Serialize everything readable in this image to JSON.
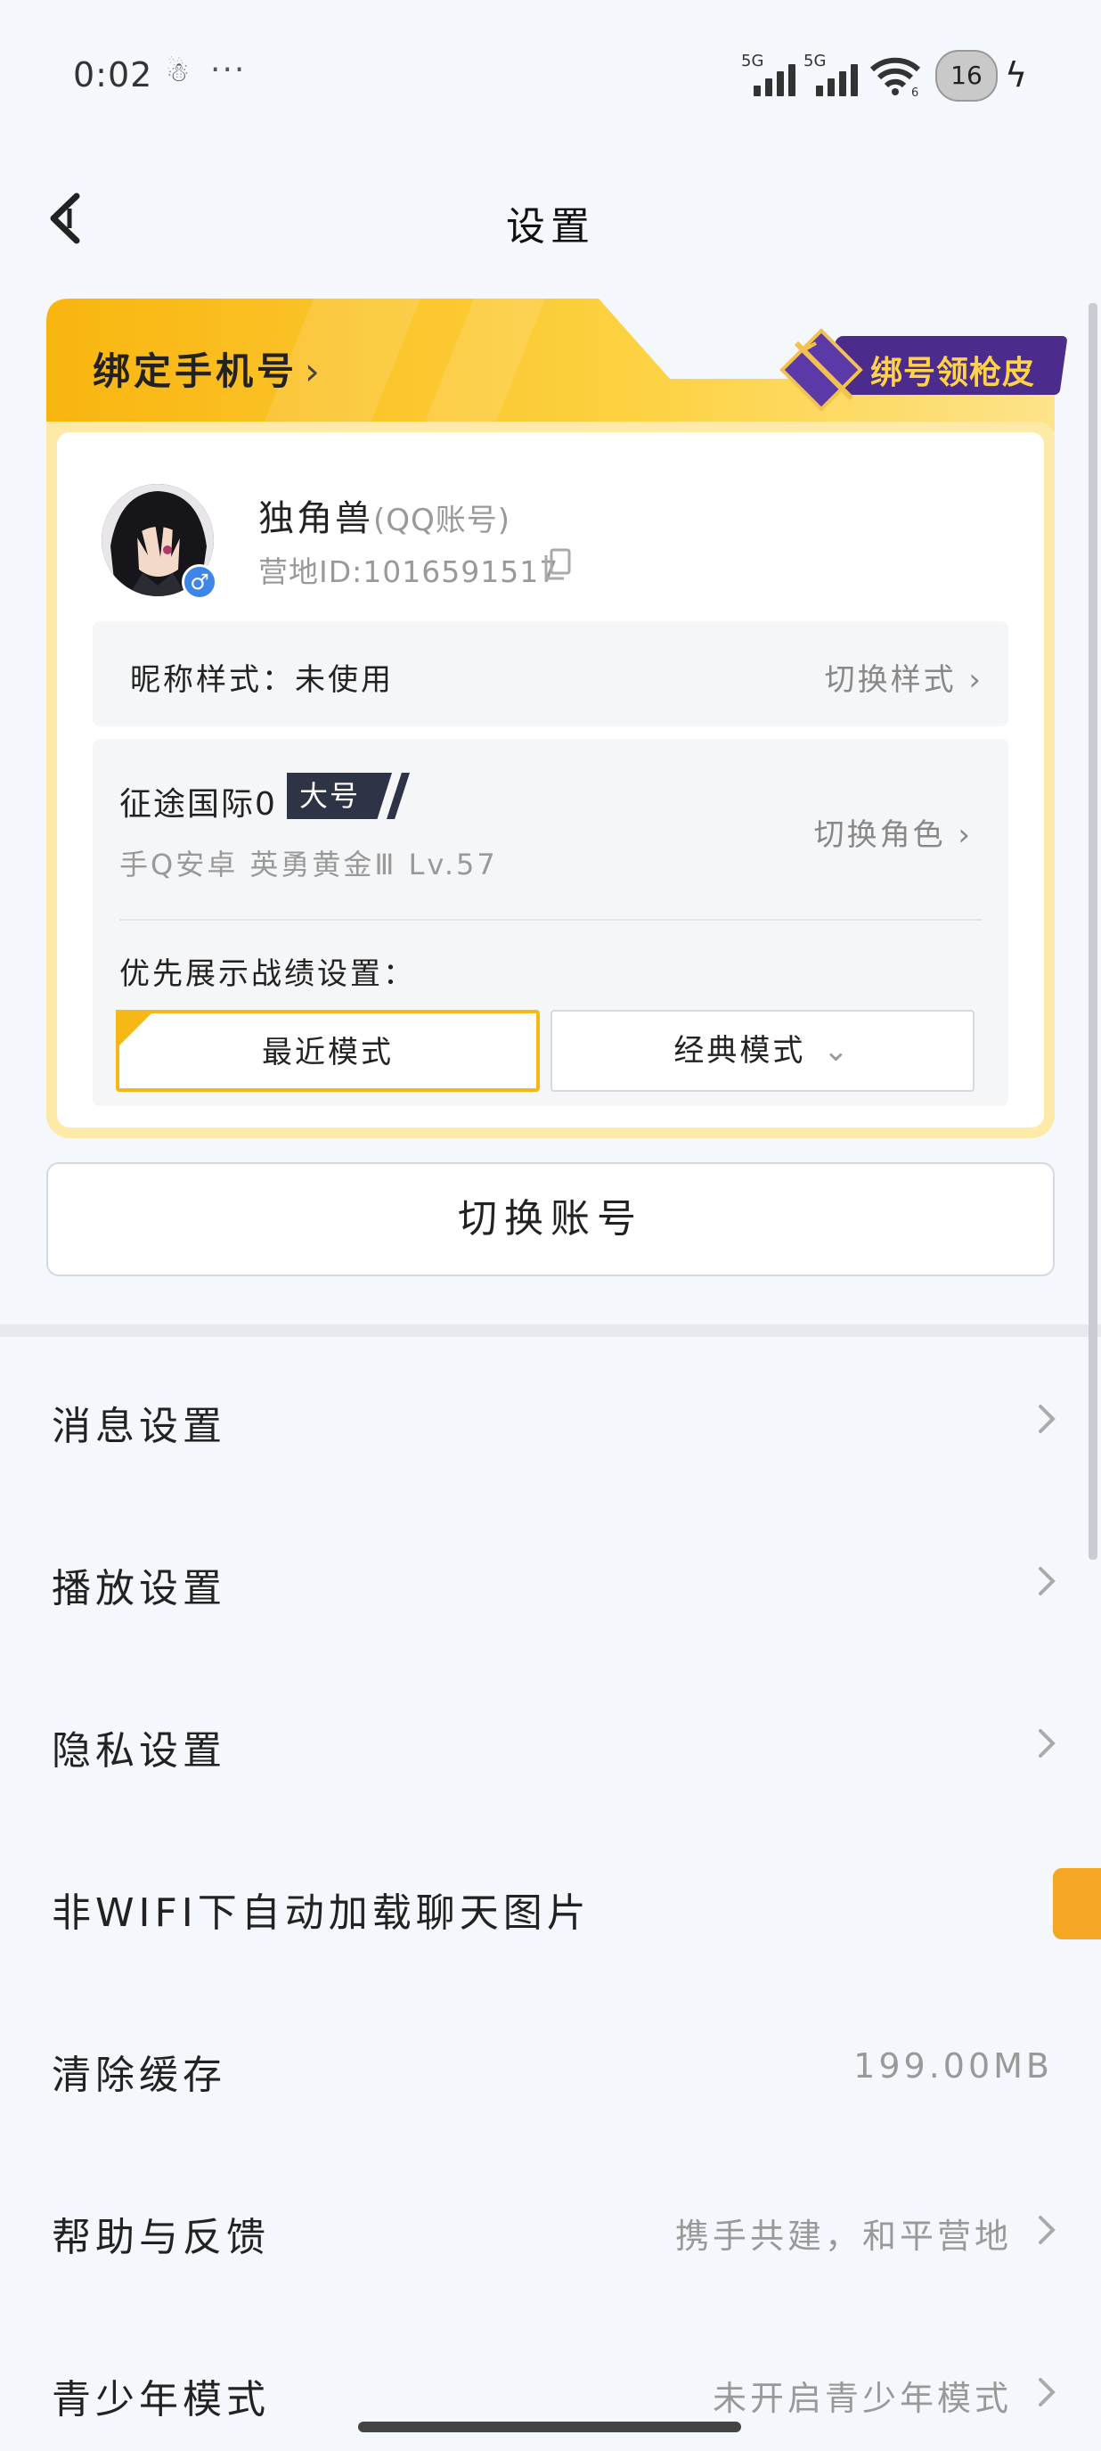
{
  "status_bar": {
    "time": "0:02",
    "dots": "···",
    "signal_1": "5G",
    "signal_2": "5G",
    "wifi_sub": "6",
    "battery": "16"
  },
  "nav": {
    "title": "设置"
  },
  "card": {
    "bind_phone_label": "绑定手机号",
    "promo_label": "绑号领枪皮",
    "user": {
      "name": "独角兽",
      "account_type": "(QQ账号)",
      "id_label": "营地ID:1016591517"
    },
    "nickname_style": {
      "label": "昵称样式：",
      "value": "未使用",
      "action": "切换样式"
    },
    "role": {
      "name": "征途国际0",
      "tag": "大号",
      "subtitle": "手Q安卓  英勇黄金Ⅲ  Lv.57",
      "action": "切换角色"
    },
    "record_pref": {
      "label": "优先展示战绩设置：",
      "mode_selected": "最近模式",
      "mode_other": "经典模式"
    }
  },
  "switch_account": "切换账号",
  "settings": [
    {
      "label": "消息设置",
      "value": ""
    },
    {
      "label": "播放设置",
      "value": ""
    },
    {
      "label": "隐私设置",
      "value": ""
    },
    {
      "label": "非WIFI下自动加载聊天图片",
      "value": "",
      "toggle_on": true
    },
    {
      "label": "清除缓存",
      "value": "199.00MB"
    },
    {
      "label": "帮助与反馈",
      "value": "携手共建，和平营地"
    },
    {
      "label": "青少年模式",
      "value": "未开启青少年模式"
    }
  ],
  "colors": {
    "accent": "#f5b816",
    "toggle": "#f5a623",
    "promo": "#4b2b8c",
    "tag": "#2e3346"
  }
}
